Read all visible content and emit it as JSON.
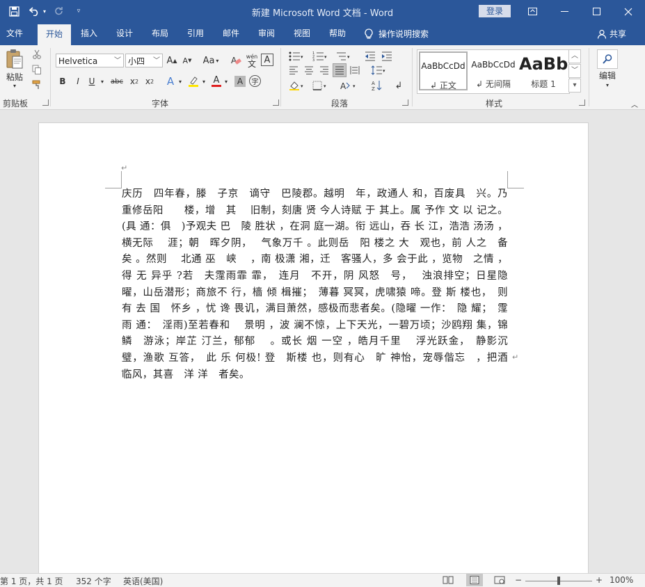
{
  "titlebar": {
    "title": "新建 Microsoft Word 文档  -  Word",
    "login": "登录"
  },
  "tabs": [
    "文件",
    "开始",
    "插入",
    "设计",
    "布局",
    "引用",
    "邮件",
    "审阅",
    "视图",
    "帮助"
  ],
  "active_tab": "开始",
  "tellme": "操作说明搜索",
  "share": "共享",
  "clipboard": {
    "paste": "粘贴",
    "label": "剪贴板"
  },
  "font": {
    "name": "Helvetica",
    "size": "小四",
    "label": "字体",
    "case": "Aa",
    "wen": "wén",
    "char_wen": "文"
  },
  "paragraph": {
    "label": "段落"
  },
  "styles": {
    "label": "样式",
    "items": [
      {
        "preview": "AaBbCcDd",
        "name": "正文"
      },
      {
        "preview": "AaBbCcDd",
        "name": "无间隔"
      },
      {
        "preview": "AaBb",
        "name": "标题 1"
      }
    ]
  },
  "editing": {
    "label": "编辑"
  },
  "document": {
    "text": "庆历　四年春，滕　子京　谪守　巴陵郡。越明　年，政通人 和，百废具　兴。乃重修岳阳　　楼，增　其　 旧制，刻唐 贤 今人诗赋 于 其上。属 予作 文 以 记之。(具 通：俱　)予观夫 巴　陵 胜状 ，在洞 庭一湖。衔 远山，吞 长 江，浩浩 汤汤 ，横无际　 涯；朝　晖夕阴，　 气象万千 。此则岳　阳 楼之 大　观也，前 人之　备矣 。然则　 北通 巫　峡 　，南 极潇 湘，迁　客骚人，多 会于此 ，览物　之情 ，得 无 异乎 ?若　夫霪雨霏 霏，　连月　不开，阴 风怒　号，　 浊浪排空；日星隐曜，山岳潜形；商旅不 行，樯 倾 楫摧；　薄暮 冥冥，虎啸猿 啼。登 斯 楼也，　则有 去 国　怀乡 ，忧 谗 畏讥，满目萧然，感极而悲者矣。(隐曜 一作：　隐 耀；　霪 雨 通：　淫雨)至若春和　 景明 ，波 澜不惊，上下天光，一碧万顷；沙鸥翔 集，锦鳞　游泳；岸芷 汀兰，郁郁　 。或长 烟 一空 ，皓月千里　 浮光跃金，　静影沉璧，渔歌 互答，　此 乐 何极! 登　斯楼 也，则有心　旷 神怡，宠辱偕忘　，把酒 临风，其喜　洋 洋　者矣。",
    "para_mark": "↵"
  },
  "status": {
    "page": "第 1 页，共 1 页",
    "words": "352 个字",
    "lang": "英语(美国)",
    "zoom": "100%",
    "zoom_minus": "−",
    "zoom_plus": "+"
  }
}
